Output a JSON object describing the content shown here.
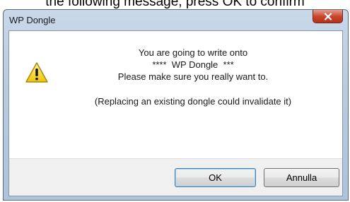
{
  "background_caption": "the following message, press OK to confirm",
  "dialog": {
    "title": "WP Dongle",
    "close_glyph": "x",
    "icon": "warning-icon",
    "message_lines": [
      "You are going to write onto",
      "****  WP Dongle  ***",
      "Please make sure you really want to.",
      "(Replacing an existing dongle could invalidate it)"
    ],
    "buttons": {
      "ok_label": "OK",
      "cancel_label": "Annulla"
    }
  },
  "colors": {
    "titlebar": "#b9cbe0",
    "close_button": "#c7432b",
    "warning_fill": "#f5d320",
    "default_button_border": "#3c7fb1"
  }
}
